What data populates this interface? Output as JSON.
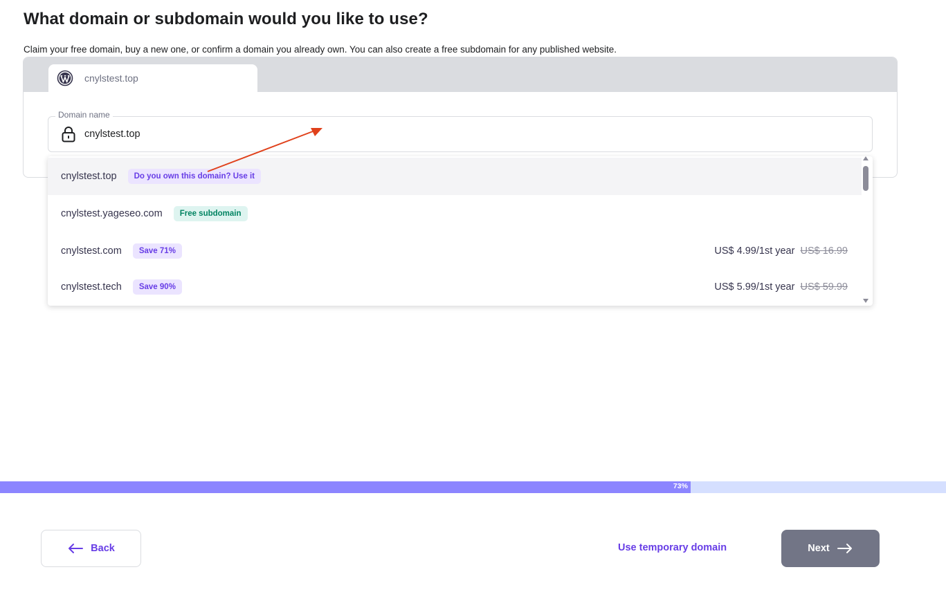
{
  "header": {
    "title": "What domain or subdomain would you like to use?",
    "subtitle": "Claim your free domain, buy a new one, or confirm a domain you already own. You can also create a free subdomain for any published website."
  },
  "site_tab": {
    "label": "cnylstest.top",
    "icon": "wordpress-icon"
  },
  "domain_field": {
    "legend": "Domain name",
    "value": "cnylstest.top",
    "icon": "lock-icon"
  },
  "suggestions": [
    {
      "domain": "cnylstest.top",
      "badge": "Do you own this domain? Use it",
      "badge_style": "purple",
      "price": "",
      "old_price": "",
      "highlighted": true
    },
    {
      "domain": "cnylstest.yageseo.com",
      "badge": "Free subdomain",
      "badge_style": "green",
      "price": "",
      "old_price": "",
      "highlighted": false
    },
    {
      "domain": "cnylstest.com",
      "badge": "Save 71%",
      "badge_style": "purple",
      "price": "US$ 4.99/1st year",
      "old_price": "US$ 16.99",
      "highlighted": false
    },
    {
      "domain": "cnylstest.tech",
      "badge": "Save 90%",
      "badge_style": "purple",
      "price": "US$ 5.99/1st year",
      "old_price": "US$ 59.99",
      "highlighted": false
    }
  ],
  "progress": {
    "percent": 73,
    "label": "73%"
  },
  "footer": {
    "back_label": "Back",
    "temp_domain_label": "Use temporary domain",
    "next_label": "Next"
  },
  "colors": {
    "accent": "#673de6",
    "annotation_arrow": "#e0411b",
    "progress_fill": "#8c85ff",
    "progress_track": "#d5dfff",
    "next_button": "#727586"
  }
}
